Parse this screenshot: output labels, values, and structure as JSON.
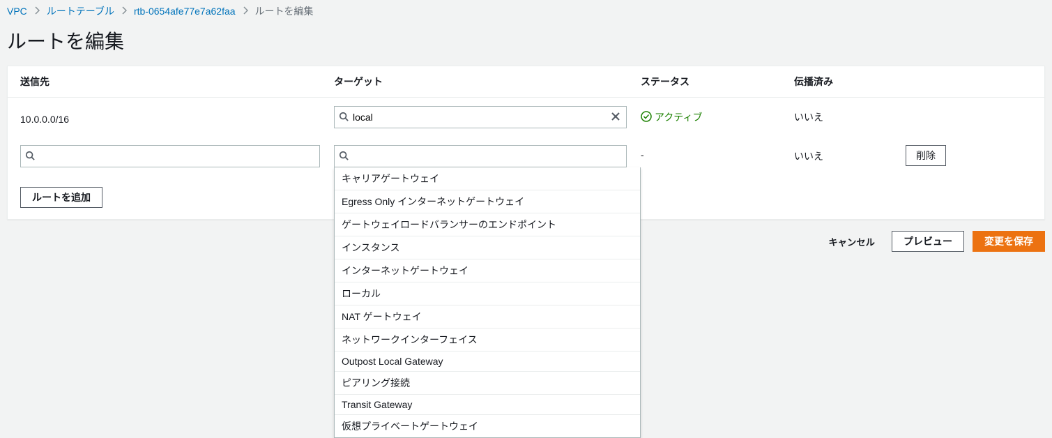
{
  "breadcrumb": {
    "vpc": "VPC",
    "route_tables": "ルートテーブル",
    "rtb_id": "rtb-0654afe77e7a62faa",
    "current": "ルートを編集"
  },
  "page_title": "ルートを編集",
  "headers": {
    "destination": "送信先",
    "target": "ターゲット",
    "status": "ステータス",
    "propagated": "伝播済み"
  },
  "rows": [
    {
      "destination": "10.0.0.0/16",
      "target": "local",
      "status_text": "アクティブ",
      "status_kind": "active",
      "propagated": "いいえ",
      "deletable": false
    },
    {
      "destination": "",
      "target": "",
      "status_text": "-",
      "status_kind": "none",
      "propagated": "いいえ",
      "deletable": true
    }
  ],
  "target_dropdown_options": [
    "キャリアゲートウェイ",
    "Egress Only インターネットゲートウェイ",
    "ゲートウェイロードバランサーのエンドポイント",
    "インスタンス",
    "インターネットゲートウェイ",
    "ローカル",
    "NAT ゲートウェイ",
    "ネットワークインターフェイス",
    "Outpost Local Gateway",
    "ピアリング接続",
    "Transit Gateway",
    "仮想プライベートゲートウェイ"
  ],
  "buttons": {
    "delete": "削除",
    "add_route": "ルートを追加",
    "cancel": "キャンセル",
    "preview": "プレビュー",
    "save": "変更を保存"
  }
}
